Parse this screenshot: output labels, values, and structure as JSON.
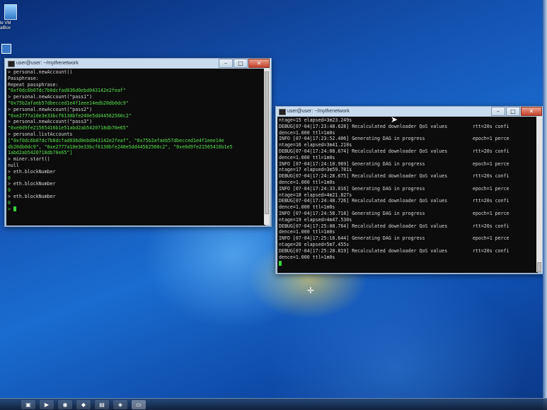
{
  "desktop": {
    "icon_label": "le VM\nalBox"
  },
  "left_window": {
    "title": "user@user: ~/mythenetwork",
    "lines": [
      {
        "t": "> personal.newAccount()",
        "c": ""
      },
      {
        "t": "Passphrase:",
        "c": ""
      },
      {
        "t": "Repeat passphrase:",
        "c": ""
      },
      {
        "t": "\"0xf0dc6b07dc7b0dcfad036d0ebd043142e2feaf\"",
        "c": "g"
      },
      {
        "t": "> personal.newAccount(\"pass1\")",
        "c": ""
      },
      {
        "t": "\"0x75b2afaeb57dbecced1e4f1eee14edb20db0dc9\"",
        "c": "g"
      },
      {
        "t": "> personal.newAccount(\"pass2\")",
        "c": ""
      },
      {
        "t": "\"0xe2777a10e3e33bcf6130bfe240e5dd44562560c2\"",
        "c": "g"
      },
      {
        "t": "> personal.newAccount(\"pass3\")",
        "c": ""
      },
      {
        "t": "\"0xe0d9fe21565416b1e51abd2ab5420718db70e65\"",
        "c": "g"
      },
      {
        "t": "> personal.listAccounts",
        "c": ""
      },
      {
        "t": "[\"0xf0dc6b07dc7b0dcfad036d0ebd043142e2feaf\", \"0x75b2afaeb57dbecced1e4f1eee14e",
        "c": "g"
      },
      {
        "t": "db20db0dc9\", \"0xe2777a10e3e33bcf6130bfe240e5dd44562560c2\", \"0xe0d9fe21565416b1e5",
        "c": "g"
      },
      {
        "t": "1abd2ab5420718db70e65\"]",
        "c": "g"
      },
      {
        "t": "> miner.start()",
        "c": ""
      },
      {
        "t": "null",
        "c": ""
      },
      {
        "t": "> eth.blockNumber",
        "c": ""
      },
      {
        "t": "0",
        "c": "g"
      },
      {
        "t": "> eth.blockNumber",
        "c": ""
      },
      {
        "t": "0",
        "c": "g"
      },
      {
        "t": "> eth.blockNumber",
        "c": ""
      },
      {
        "t": "0",
        "c": "g"
      }
    ],
    "prompt": "> "
  },
  "right_window": {
    "title": "user@user: ~/mythenetwork",
    "lines": [
      "ntage=15 elapsed=3m23.249s",
      "DEBUG[07-04|17:23:48.628] Recalculated downloader QoS values         rtt=20s confi",
      "dence=1.000 ttl=1m0s",
      "INFO [07-04|17:23:52.406] Generating DAG in progress                 epoch=1 perce",
      "ntage=16 elapsed=3m41.218s",
      "DEBUG[07-04|17:24:08.674] Recalculated downloader QoS values         rtt=20s confi",
      "dence=1.000 ttl=1m0s",
      "INFO [07-04|17:24:10.969] Generating DAG in progress                 epoch=1 perce",
      "ntage=17 elapsed=3m59.781s",
      "DEBUG[07-04|17:24:28.675] Recalculated downloader QoS values         rtt=20s confi",
      "dence=1.000 ttl=1m0s",
      "INFO [07-04|17:24:33.016] Generating DAG in progress                 epoch=1 perce",
      "ntage=18 elapsed=4m21.827s",
      "DEBUG[07-04|17:24:48.726] Recalculated downloader QoS values         rtt=20s confi",
      "dence=1.000 ttl=1m0s",
      "INFO [07-04|17:24:58.718] Generating DAG in progress                 epoch=1 perce",
      "ntage=19 elapsed=4m47.530s",
      "DEBUG[07-04|17:25:08.764] Recalculated downloader QoS values         rtt=20s confi",
      "dence=1.000 ttl=1m0s",
      "INFO [07-04|17:25:18.644] Generating DAG in progress                 epoch=1 perce",
      "ntage=20 elapsed=5m7.455s",
      "DEBUG[07-04|17:25:28.819] Recalculated downloader QoS values         rtt=20s confi",
      "dence=1.000 ttl=1m0s"
    ]
  },
  "controls": {
    "minimize": "–",
    "maximize": "□",
    "close": "✕"
  },
  "taskbar": {
    "items": [
      {
        "icon": "folder-icon",
        "glyph": "▣"
      },
      {
        "icon": "media-icon",
        "glyph": "▶"
      },
      {
        "icon": "chrome-icon",
        "glyph": "◉"
      },
      {
        "icon": "virtualbox-icon",
        "glyph": "◆"
      },
      {
        "icon": "files-icon",
        "glyph": "▤"
      },
      {
        "icon": "python-icon",
        "glyph": "◈"
      },
      {
        "icon": "terminal-icon",
        "glyph": "▭"
      }
    ]
  }
}
